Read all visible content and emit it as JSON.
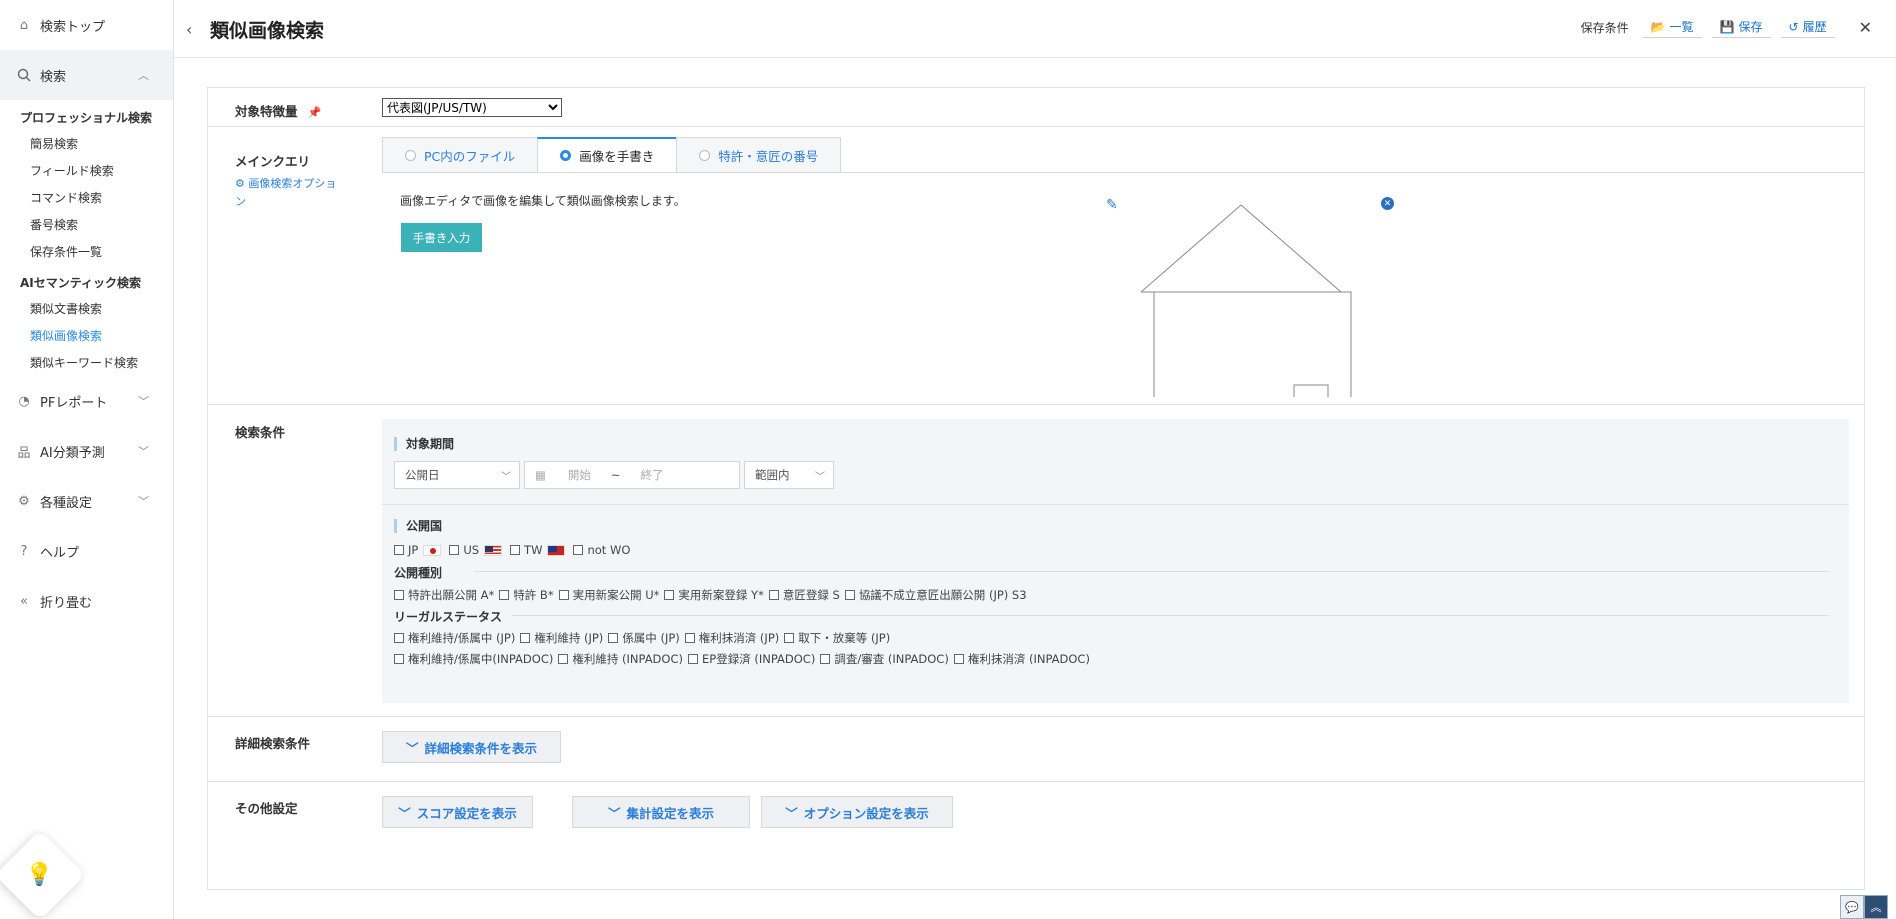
{
  "sidebar": {
    "top": "検索トップ",
    "search": "検索",
    "pro_group": "プロフェッショナル検索",
    "pro_items": [
      "簡易検索",
      "フィールド検索",
      "コマンド検索",
      "番号検索",
      "保存条件一覧"
    ],
    "ai_group": "AIセマンティック検索",
    "ai_items": [
      "類似文書検索",
      "類似画像検索",
      "類似キーワード検索"
    ],
    "pf_report": "PFレポート",
    "ai_classify": "AI分類予測",
    "settings": "各種設定",
    "help": "ヘルプ",
    "collapse": "折り畳む"
  },
  "header": {
    "title": "類似画像検索",
    "saved_label": "保存条件",
    "list_btn": "一覧",
    "save_btn": "保存",
    "history_btn": "履歴"
  },
  "target": {
    "label": "対象特徴量",
    "selected": "代表図(JP/US/TW)"
  },
  "main_query": {
    "label": "メインクエリ",
    "option_link": "画像検索オプション",
    "tabs": [
      "PC内のファイル",
      "画像を手書き",
      "特許・意匠の番号"
    ],
    "active_tab": 1,
    "editor_message": "画像エディタで画像を編集して類似画像検索します。",
    "draw_button": "手書き入力"
  },
  "conditions": {
    "label": "検索条件",
    "period_title": "対象期間",
    "date_type": "公開日",
    "start_placeholder": "開始",
    "tilde": "~",
    "end_placeholder": "終了",
    "range": "範囲内",
    "country_title": "公開国",
    "countries": [
      "JP",
      "US",
      "TW",
      "not WO"
    ],
    "pubtype_title": "公開種別",
    "pubtypes": [
      "特許出願公開 A*",
      "特許 B*",
      "実用新案公開 U*",
      "実用新案登録 Y*",
      "意匠登録 S",
      "協議不成立意匠出願公開 (JP) S3"
    ],
    "legal_title": "リーガルステータス",
    "legal_row1": [
      "権利維持/係属中 (JP)",
      "権利維持 (JP)",
      "係属中 (JP)",
      "権利抹消済 (JP)",
      "取下・放棄等 (JP)"
    ],
    "legal_row2": [
      "権利維持/係属中(INPADOC)",
      "権利維持 (INPADOC)",
      "EP登録済 (INPADOC)",
      "調査/審査 (INPADOC)",
      "権利抹消済 (INPADOC)"
    ]
  },
  "detail": {
    "label": "詳細検索条件",
    "button": "詳細検索条件を表示"
  },
  "other": {
    "label": "その他設定",
    "score_btn": "スコア設定を表示",
    "agg_btn": "集計設定を表示",
    "opt_btn": "オプション設定を表示"
  }
}
